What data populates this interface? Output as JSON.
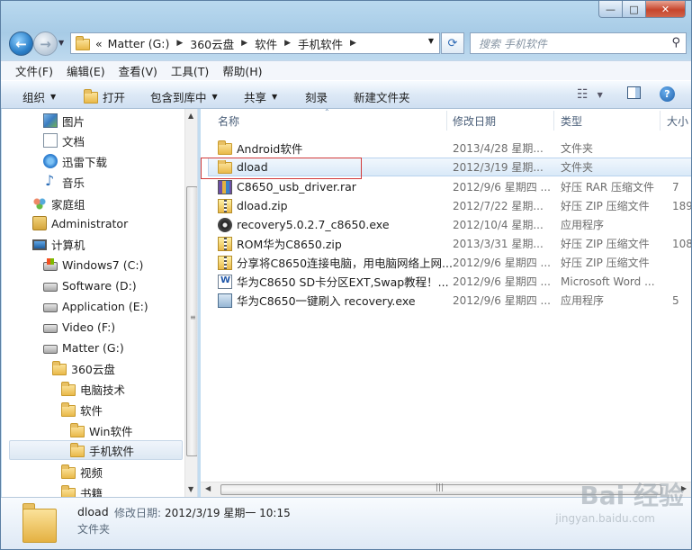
{
  "window": {
    "caption": {
      "minimize": "—",
      "maximize": "□",
      "close": "✕"
    }
  },
  "address": {
    "overflow": "«",
    "crumbs": [
      "Matter (G:)",
      "360云盘",
      "软件",
      "手机软件"
    ],
    "search_placeholder": "搜索 手机软件"
  },
  "menu": [
    "文件(F)",
    "编辑(E)",
    "查看(V)",
    "工具(T)",
    "帮助(H)"
  ],
  "commands": {
    "organize": "组织",
    "open": "打开",
    "include": "包含到库中",
    "share": "共享",
    "burn": "刻录",
    "new_folder": "新建文件夹"
  },
  "tree": [
    {
      "label": "图片",
      "icon": "pictures-icon"
    },
    {
      "label": "文档",
      "icon": "documents-icon"
    },
    {
      "label": "迅雷下载",
      "icon": "thunder-download-icon"
    },
    {
      "label": "音乐",
      "icon": "music-icon"
    },
    {
      "label": "家庭组",
      "icon": "homegroup-icon"
    },
    {
      "label": "Administrator",
      "icon": "user-folder-icon"
    },
    {
      "label": "计算机",
      "icon": "computer-icon"
    },
    {
      "label": "Windows7 (C:)",
      "icon": "system-drive-icon"
    },
    {
      "label": "Software (D:)",
      "icon": "drive-icon"
    },
    {
      "label": "Application (E:)",
      "icon": "drive-icon"
    },
    {
      "label": "Video (F:)",
      "icon": "drive-icon"
    },
    {
      "label": "Matter (G:)",
      "icon": "drive-icon"
    },
    {
      "label": "360云盘",
      "icon": "folder-icon"
    },
    {
      "label": "电脑技术",
      "icon": "folder-icon"
    },
    {
      "label": "软件",
      "icon": "folder-icon"
    },
    {
      "label": "Win软件",
      "icon": "folder-icon"
    },
    {
      "label": "手机软件",
      "icon": "folder-icon"
    },
    {
      "label": "视频",
      "icon": "folder-icon"
    },
    {
      "label": "书籍",
      "icon": "folder-icon"
    }
  ],
  "columns": {
    "name": "名称",
    "date": "修改日期",
    "type": "类型",
    "size": "大小"
  },
  "files": [
    {
      "name": "Android软件",
      "date": "2013/4/28 星期...",
      "type": "文件夹",
      "size": "",
      "icon": "folder-icon"
    },
    {
      "name": "dload",
      "date": "2012/3/19 星期...",
      "type": "文件夹",
      "size": "",
      "icon": "folder-icon"
    },
    {
      "name": "C8650_usb_driver.rar",
      "date": "2012/9/6 星期四 ...",
      "type": "好压 RAR 压缩文件",
      "size": "7",
      "icon": "rar-archive-icon"
    },
    {
      "name": "dload.zip",
      "date": "2012/7/22 星期...",
      "type": "好压 ZIP 压缩文件",
      "size": "189",
      "icon": "zip-archive-icon"
    },
    {
      "name": "recovery5.0.2.7_c8650.exe",
      "date": "2012/10/4 星期...",
      "type": "应用程序",
      "size": "",
      "icon": "exe-disc-icon"
    },
    {
      "name": "ROM华为C8650.zip",
      "date": "2013/3/31 星期...",
      "type": "好压 ZIP 压缩文件",
      "size": "108",
      "icon": "zip-archive-icon"
    },
    {
      "name": "分享将C8650连接电脑，用电脑网络上网...",
      "date": "2012/9/6 星期四 ...",
      "type": "好压 ZIP 压缩文件",
      "size": "",
      "icon": "zip-archive-icon"
    },
    {
      "name": "华为C8650 SD卡分区EXT,Swap教程！...",
      "date": "2012/9/6 星期四 ...",
      "type": "Microsoft Word ...",
      "size": "",
      "icon": "word-document-icon"
    },
    {
      "name": "华为C8650一键刷入 recovery.exe",
      "date": "2012/9/6 星期四 ...",
      "type": "应用程序",
      "size": "5",
      "icon": "exe-app-icon"
    }
  ],
  "details": {
    "name": "dload",
    "modified_label": "修改日期:",
    "modified_value": "2012/3/19 星期一 10:15",
    "type": "文件夹"
  },
  "watermark": {
    "brand": "Bai 经验",
    "url": "jingyan.baidu.com"
  }
}
